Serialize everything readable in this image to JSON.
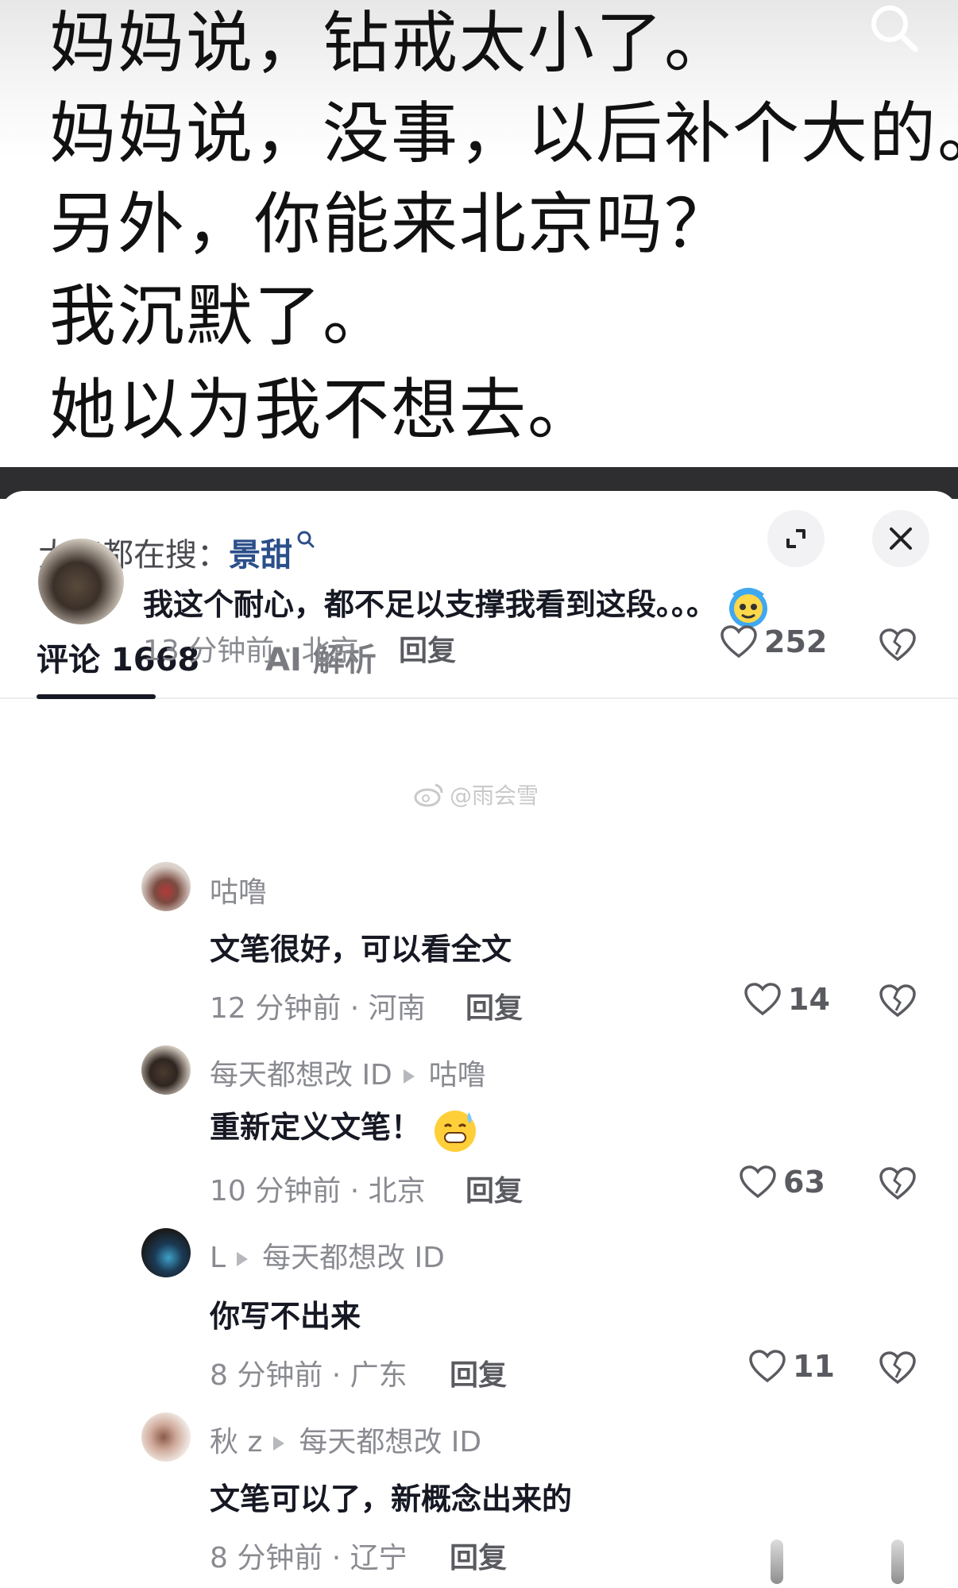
{
  "story": {
    "lines": [
      "妈妈说，钻戒太小了。",
      "妈妈说，没事，以后补个大的。",
      "另外，你能来北京吗？",
      "我沉默了。",
      "她以为我不想去。"
    ]
  },
  "header": {
    "hot_search_prefix": "大家都在搜：",
    "hot_search_keyword": "景甜"
  },
  "tabs": [
    {
      "label": "评论 1668"
    },
    {
      "label": "AI 解析"
    }
  ],
  "watermark": "@雨会雪",
  "comments": [
    {
      "text": "我这个耐心，都不足以支撑我看到这段。。。",
      "time_location": "13 分钟前 · 北京",
      "reply_label": "回复",
      "likes": "252"
    }
  ],
  "replies": [
    {
      "name": "咕噜",
      "reply_to": "",
      "text": "文笔很好，可以看全文",
      "time_location": "12 分钟前 · 河南",
      "reply_label": "回复",
      "likes": "14"
    },
    {
      "name": "每天都想改 ID",
      "reply_to": "咕噜",
      "text": "重新定义文笔！",
      "time_location": "10 分钟前 · 北京",
      "reply_label": "回复",
      "likes": "63"
    },
    {
      "name": "L",
      "reply_to": "每天都想改 ID",
      "text": "你写不出来",
      "time_location": "8 分钟前 · 广东",
      "reply_label": "回复",
      "likes": "11"
    },
    {
      "name": "秋 z",
      "reply_to": "每天都想改 ID",
      "text": "文笔可以了，新概念出来的",
      "time_location": "8 分钟前 · 辽宁",
      "reply_label": "回复"
    }
  ],
  "icons": {
    "search": "search-icon",
    "expand": "expand-icon",
    "close": "close-icon",
    "like": "heart-icon",
    "dislike": "broken-heart-icon"
  },
  "colors": {
    "keyword": "#2b4f8a",
    "text": "#161823",
    "meta": "#8a8b91"
  }
}
